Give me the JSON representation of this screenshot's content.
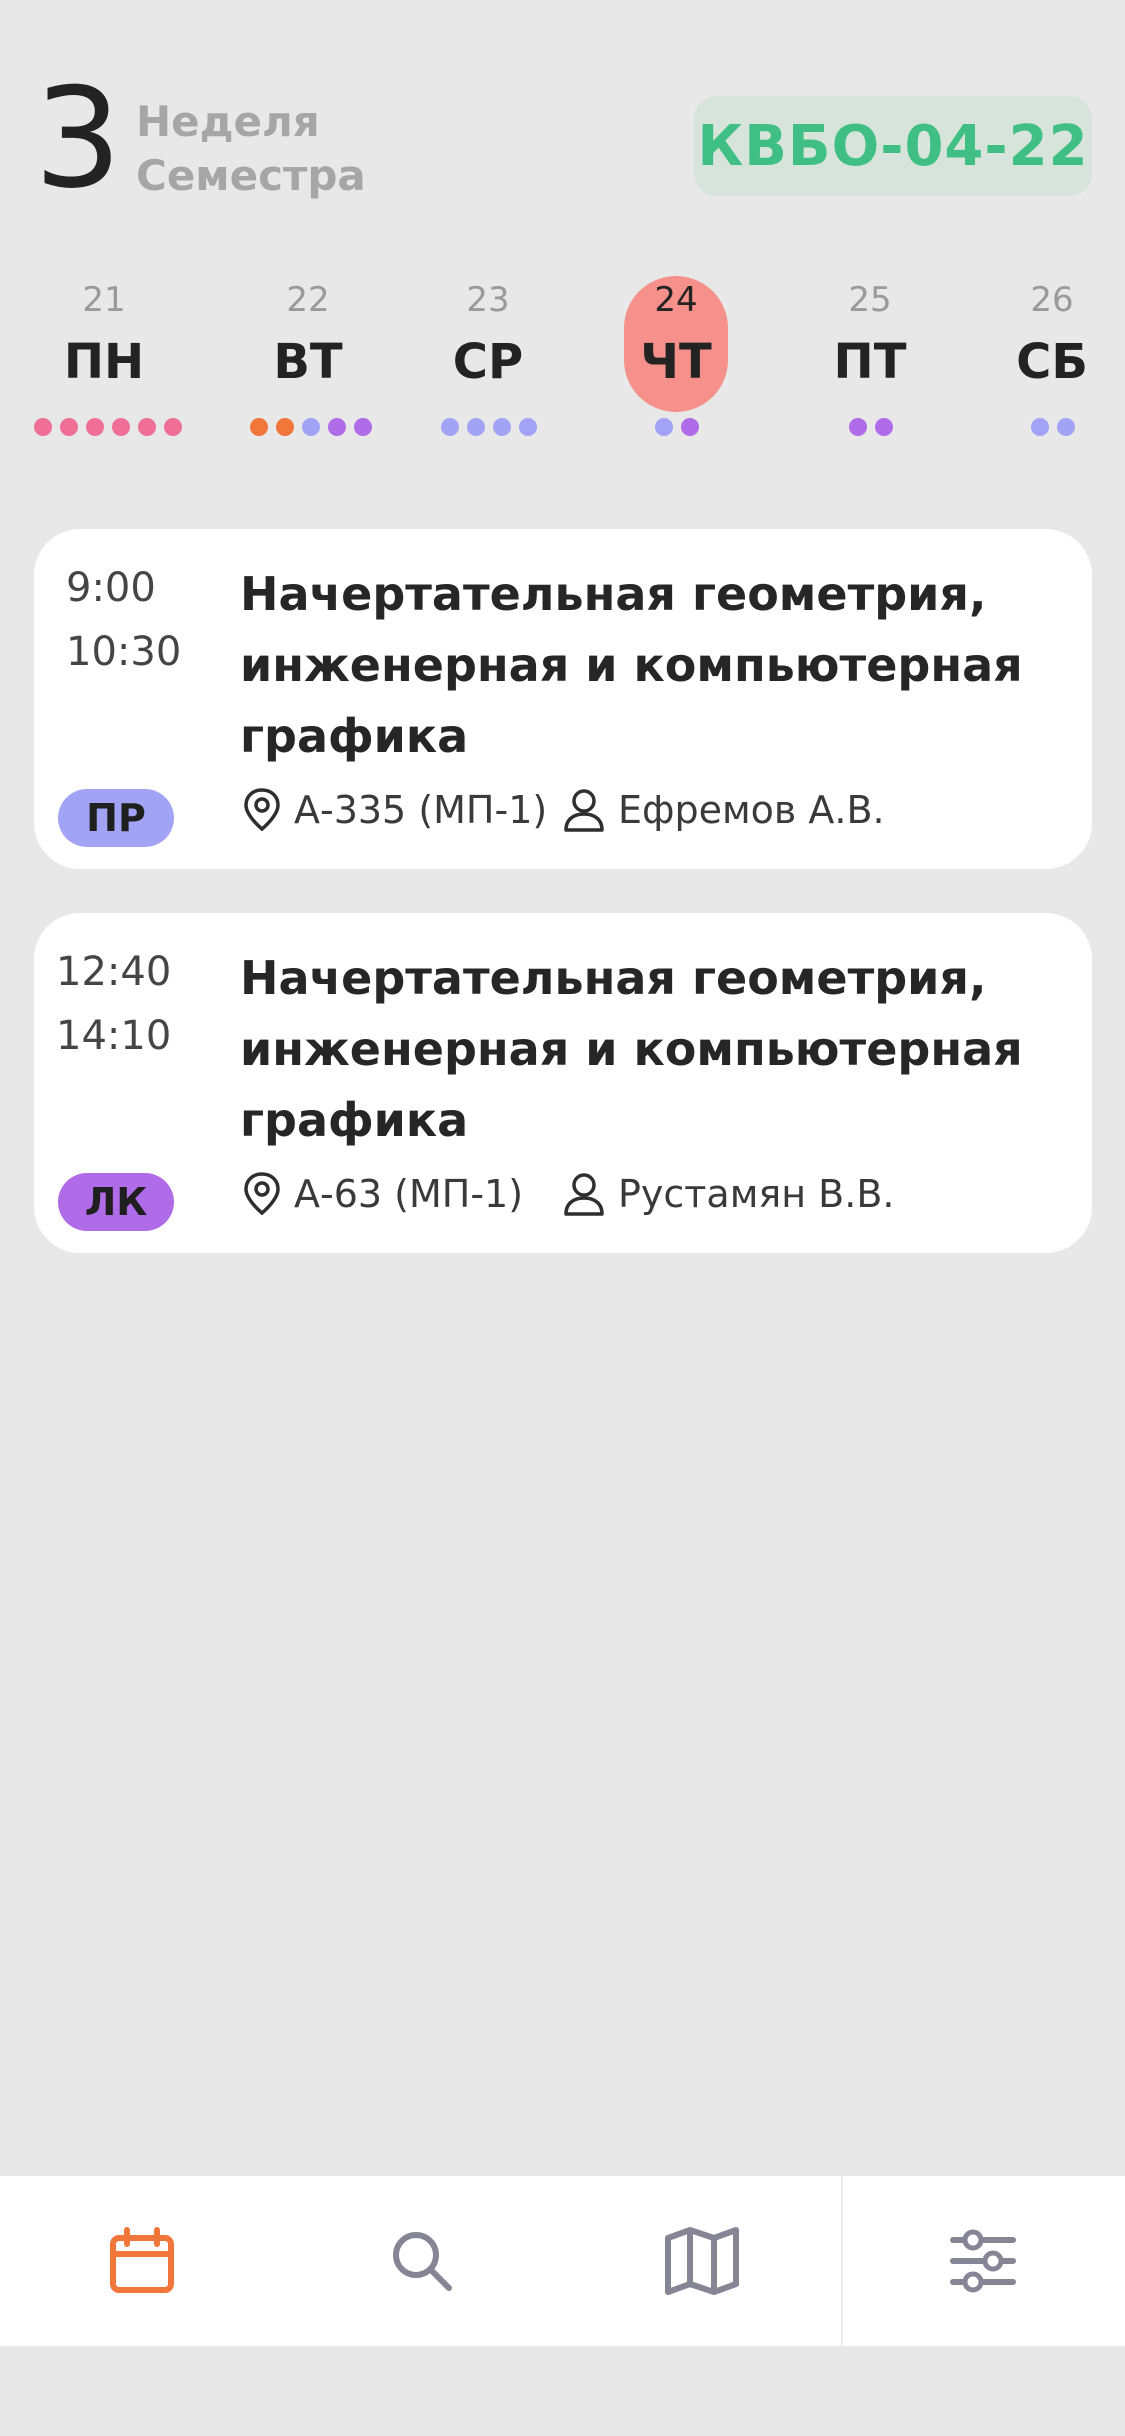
{
  "header": {
    "week_number": "3",
    "week_label_line1": "Неделя",
    "week_label_line2": "Семестра",
    "group": "КВБО-04-22"
  },
  "days": [
    {
      "num": "21",
      "name": "ПН",
      "dots": [
        "#f06f96",
        "#f06f96",
        "#f06f96",
        "#f06f96",
        "#f06f96",
        "#f06f96"
      ]
    },
    {
      "num": "22",
      "name": "ВТ",
      "dots": [
        "#f0763a",
        "#f0763a",
        "#a1a4f5",
        "#b06be8",
        "#b06be8"
      ]
    },
    {
      "num": "23",
      "name": "СР",
      "dots": [
        "#a1a4f5",
        "#a1a4f5",
        "#a1a4f5",
        "#a1a4f5"
      ]
    },
    {
      "num": "24",
      "name": "ЧТ",
      "dots": [
        "#a1a4f5",
        "#b06be8"
      ],
      "active": true
    },
    {
      "num": "25",
      "name": "ПТ",
      "dots": [
        "#b06be8",
        "#b06be8"
      ]
    },
    {
      "num": "26",
      "name": "СБ",
      "dots": [
        "#a1a4f5",
        "#a1a4f5"
      ]
    }
  ],
  "lessons": [
    {
      "start": "9:00",
      "end": "10:30",
      "title_line1": "Начертательная геометрия,",
      "title_line2": "инженерная и компьютерная",
      "title_line3": "графика",
      "type": "ПР",
      "type_color": "#a1a4f5",
      "room": "А-335 (МП-1)",
      "teacher": "Ефремов А.В."
    },
    {
      "start": "12:40",
      "end": "14:10",
      "title_line1": "Начертательная геометрия,",
      "title_line2": "инженерная и компьютерная",
      "title_line3": "графика",
      "type": "ЛК",
      "type_color": "#b06be8",
      "room": "А-63 (МП-1)",
      "teacher": "Рустамян В.В."
    }
  ],
  "nav": {
    "items": [
      "calendar-icon",
      "search-icon",
      "map-icon",
      "settings-sliders-icon"
    ],
    "active_color": "#f0763a",
    "inactive_color": "#858595"
  }
}
